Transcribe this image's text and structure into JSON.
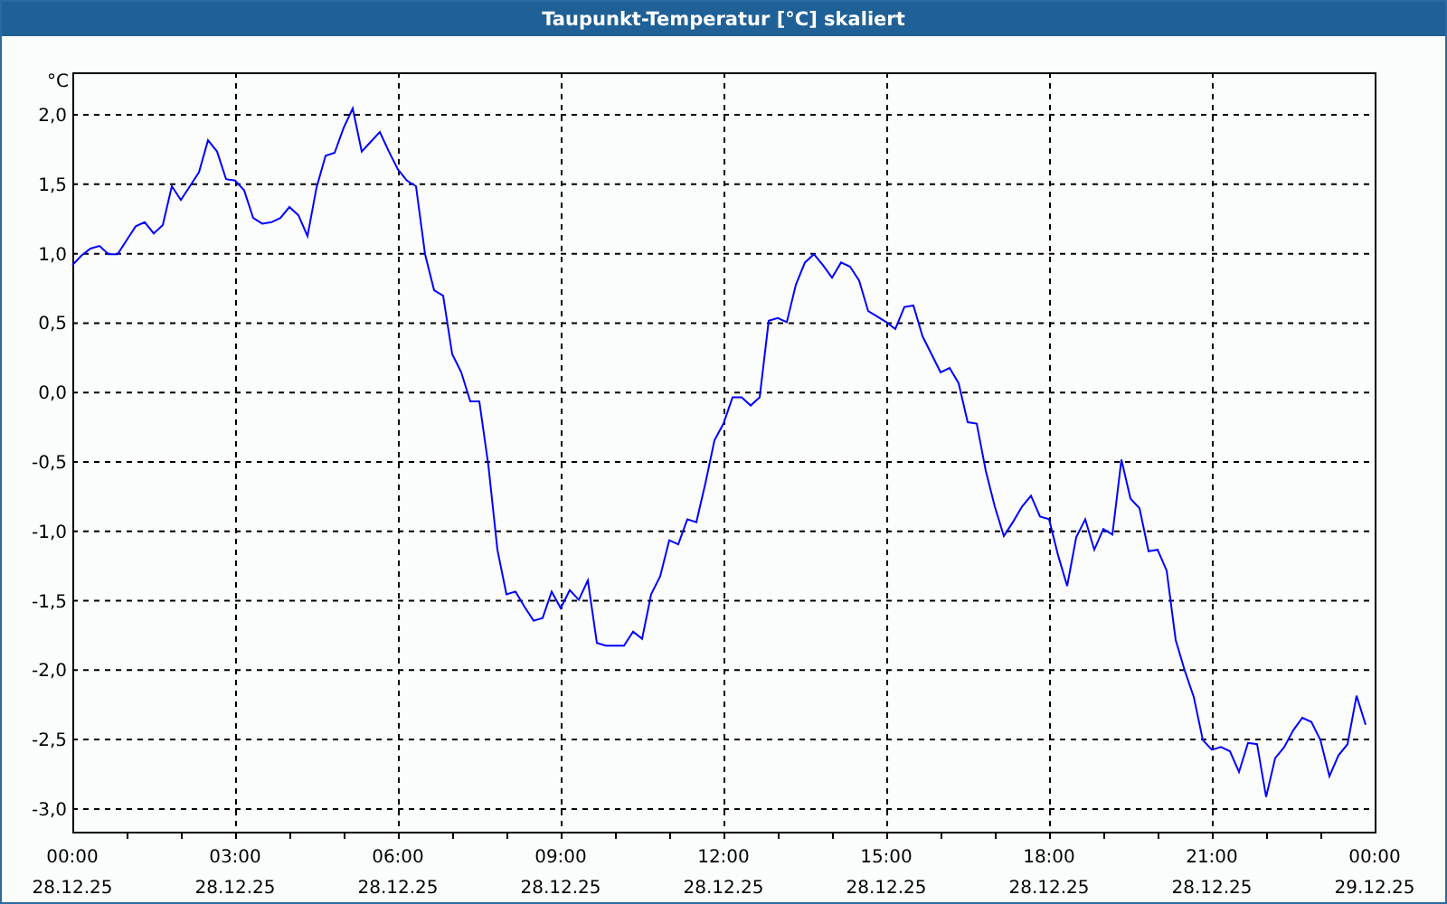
{
  "window": {
    "title": "Taupunkt-Temperatur [°C] skaliert"
  },
  "chart_data": {
    "type": "line",
    "ylabel": "°C",
    "grid": true,
    "xlim": [
      "--12-28T00:00",
      "--12-29T00:00"
    ],
    "ylim": [
      -3.17,
      2.3
    ],
    "xticks": [
      {
        "value": "--12-28T00:00",
        "label": "00:00\n28.12.25"
      },
      {
        "value": "--12-28T03:00",
        "label": "03:00\n28.12.25"
      },
      {
        "value": "--12-28T06:00",
        "label": "06:00\n28.12.25"
      },
      {
        "value": "--12-28T09:00",
        "label": "09:00\n28.12.25"
      },
      {
        "value": "--12-28T12:00",
        "label": "12:00\n28.12.25"
      },
      {
        "value": "--12-28T15:00",
        "label": "15:00\n28.12.25"
      },
      {
        "value": "--12-28T18:00",
        "label": "18:00\n28.12.25"
      },
      {
        "value": "--12-28T21:00",
        "label": "21:00\n28.12.25"
      },
      {
        "value": "--12-29T00:00",
        "label": "00:00\n29.12.25"
      }
    ],
    "yticks": [
      {
        "value": 2,
        "label": "2,0"
      },
      {
        "value": 1.5,
        "label": "1,5"
      },
      {
        "value": 1,
        "label": "1,0"
      },
      {
        "value": 0.5,
        "label": "0,5"
      },
      {
        "value": 0,
        "label": "0,0"
      },
      {
        "value": -0.5,
        "label": "-0,5"
      },
      {
        "value": -1,
        "label": "-1,0"
      },
      {
        "value": -1.5,
        "label": "-1,5"
      },
      {
        "value": -2,
        "label": "-2,0"
      },
      {
        "value": -2.5,
        "label": "-2,5"
      },
      {
        "value": -3,
        "label": "-3,0"
      }
    ],
    "x": [
      "--12-28T00:00",
      "--12-28T00:10",
      "--12-28T00:20",
      "--12-28T00:30",
      "--12-28T00:40",
      "--12-28T00:50",
      "--12-28T01:00",
      "--12-28T01:10",
      "--12-28T01:20",
      "--12-28T01:30",
      "--12-28T01:40",
      "--12-28T01:50",
      "--12-28T02:00",
      "--12-28T02:10",
      "--12-28T02:20",
      "--12-28T02:30",
      "--12-28T02:40",
      "--12-28T02:50",
      "--12-28T03:00",
      "--12-28T03:10",
      "--12-28T03:20",
      "--12-28T03:30",
      "--12-28T03:40",
      "--12-28T03:50",
      "--12-28T04:00",
      "--12-28T04:10",
      "--12-28T04:20",
      "--12-28T04:30",
      "--12-28T04:40",
      "--12-28T04:50",
      "--12-28T05:00",
      "--12-28T05:10",
      "--12-28T05:20",
      "--12-28T05:30",
      "--12-28T05:40",
      "--12-28T05:50",
      "--12-28T06:00",
      "--12-28T06:10",
      "--12-28T06:20",
      "--12-28T06:30",
      "--12-28T06:40",
      "--12-28T06:50",
      "--12-28T07:00",
      "--12-28T07:10",
      "--12-28T07:20",
      "--12-28T07:30",
      "--12-28T07:40",
      "--12-28T07:50",
      "--12-28T08:00",
      "--12-28T08:10",
      "--12-28T08:20",
      "--12-28T08:30",
      "--12-28T08:40",
      "--12-28T08:50",
      "--12-28T09:00",
      "--12-28T09:10",
      "--12-28T09:20",
      "--12-28T09:30",
      "--12-28T09:40",
      "--12-28T09:50",
      "--12-28T10:00",
      "--12-28T10:10",
      "--12-28T10:20",
      "--12-28T10:30",
      "--12-28T10:40",
      "--12-28T10:50",
      "--12-28T11:00",
      "--12-28T11:10",
      "--12-28T11:20",
      "--12-28T11:30",
      "--12-28T11:40",
      "--12-28T11:50",
      "--12-28T12:00",
      "--12-28T12:10",
      "--12-28T12:20",
      "--12-28T12:30",
      "--12-28T12:40",
      "--12-28T12:50",
      "--12-28T13:00",
      "--12-28T13:10",
      "--12-28T13:20",
      "--12-28T13:30",
      "--12-28T13:40",
      "--12-28T13:50",
      "--12-28T14:00",
      "--12-28T14:10",
      "--12-28T14:20",
      "--12-28T14:30",
      "--12-28T14:40",
      "--12-28T14:50",
      "--12-28T15:00",
      "--12-28T15:10",
      "--12-28T15:20",
      "--12-28T15:30",
      "--12-28T15:40",
      "--12-28T15:50",
      "--12-28T16:00",
      "--12-28T16:10",
      "--12-28T16:20",
      "--12-28T16:30",
      "--12-28T16:40",
      "--12-28T16:50",
      "--12-28T17:00",
      "--12-28T17:10",
      "--12-28T17:20",
      "--12-28T17:30",
      "--12-28T17:40",
      "--12-28T17:50",
      "--12-28T18:00",
      "--12-28T18:10",
      "--12-28T18:20",
      "--12-28T18:30",
      "--12-28T18:40",
      "--12-28T18:50",
      "--12-28T19:00",
      "--12-28T19:10",
      "--12-28T19:20",
      "--12-28T19:30",
      "--12-28T19:40",
      "--12-28T19:50",
      "--12-28T20:00",
      "--12-28T20:10",
      "--12-28T20:20",
      "--12-28T20:30",
      "--12-28T20:40",
      "--12-28T20:50",
      "--12-28T21:00",
      "--12-28T21:10",
      "--12-28T21:20",
      "--12-28T21:30",
      "--12-28T21:40",
      "--12-28T21:50",
      "--12-28T22:00",
      "--12-28T22:10",
      "--12-28T22:20",
      "--12-28T22:30",
      "--12-28T22:40",
      "--12-28T22:50",
      "--12-28T23:00",
      "--12-28T23:10",
      "--12-28T23:20",
      "--12-28T23:30",
      "--12-28T23:40",
      "--12-28T23:50"
    ],
    "series": [
      {
        "color": "#0000ff",
        "values": [
          0.91,
          0.98,
          1.03,
          1.05,
          0.99,
          0.99,
          1.09,
          1.19,
          1.22,
          1.14,
          1.2,
          1.48,
          1.38,
          1.48,
          1.58,
          1.81,
          1.73,
          1.53,
          1.52,
          1.45,
          1.25,
          1.21,
          1.22,
          1.25,
          1.33,
          1.27,
          1.12,
          1.47,
          1.7,
          1.72,
          1.9,
          2.04,
          1.73,
          1.8,
          1.87,
          1.73,
          1.6,
          1.52,
          1.48,
          0.99,
          0.73,
          0.69,
          0.27,
          0.14,
          -0.07,
          -0.07,
          -0.53,
          -1.14,
          -1.46,
          -1.44,
          -1.55,
          -1.65,
          -1.63,
          -1.44,
          -1.56,
          -1.43,
          -1.5,
          -1.36,
          -1.81,
          -1.83,
          -1.83,
          -1.83,
          -1.73,
          -1.78,
          -1.46,
          -1.33,
          -1.07,
          -1.1,
          -0.92,
          -0.94,
          -0.66,
          -0.35,
          -0.23,
          -0.04,
          -0.04,
          -0.1,
          -0.04,
          0.51,
          0.53,
          0.5,
          0.77,
          0.93,
          0.99,
          0.91,
          0.82,
          0.93,
          0.9,
          0.8,
          0.58,
          0.54,
          0.5,
          0.45,
          0.61,
          0.62,
          0.4,
          0.27,
          0.14,
          0.17,
          0.06,
          -0.22,
          -0.23,
          -0.57,
          -0.83,
          -1.04,
          -0.94,
          -0.83,
          -0.75,
          -0.9,
          -0.92,
          -1.18,
          -1.4,
          -1.05,
          -0.92,
          -1.14,
          -0.99,
          -1.03,
          -0.49,
          -0.77,
          -0.84,
          -1.15,
          -1.14,
          -1.29,
          -1.79,
          -2.01,
          -2.2,
          -2.51,
          -2.58,
          -2.56,
          -2.59,
          -2.74,
          -2.53,
          -2.54,
          -2.92,
          -2.64,
          -2.56,
          -2.44,
          -2.35,
          -2.38,
          -2.51,
          -2.77,
          -2.62,
          -2.54,
          -2.19,
          -2.4
        ]
      }
    ]
  }
}
